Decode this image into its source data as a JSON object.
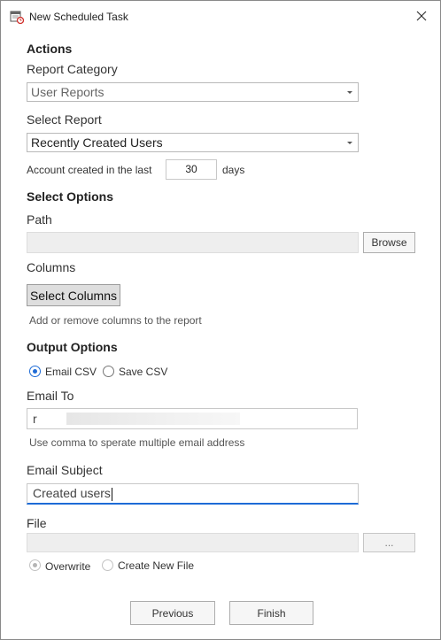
{
  "window": {
    "title": "New Scheduled Task"
  },
  "actions": {
    "heading": "Actions",
    "report_category_label": "Report Category",
    "report_category_value": "User Reports",
    "select_report_label": "Select Report",
    "select_report_value": "Recently Created Users",
    "account_created_prefix": "Account created in the last",
    "account_created_days": "30",
    "account_created_suffix": "days"
  },
  "select_options": {
    "heading": "Select Options",
    "path_label": "Path",
    "path_value": "",
    "browse_label": "Browse",
    "columns_label": "Columns",
    "select_columns_label": "Select Columns",
    "columns_hint": "Add or remove columns to the report"
  },
  "output_options": {
    "heading": "Output Options",
    "email_csv_label": "Email CSV",
    "save_csv_label": "Save CSV",
    "selected": "Email CSV",
    "email_to_label": "Email To",
    "email_to_value": "r",
    "email_hint": "Use comma to sperate multiple email address",
    "email_subject_label": "Email Subject",
    "email_subject_value": "Created users",
    "file_label": "File",
    "file_browse_label": "...",
    "overwrite_label": "Overwrite",
    "create_new_file_label": "Create New File"
  },
  "footer": {
    "previous_label": "Previous",
    "finish_label": "Finish"
  },
  "colors": {
    "accent": "#1e6bd6",
    "border": "#b9b9b9",
    "disabled": "#eeeeee"
  }
}
